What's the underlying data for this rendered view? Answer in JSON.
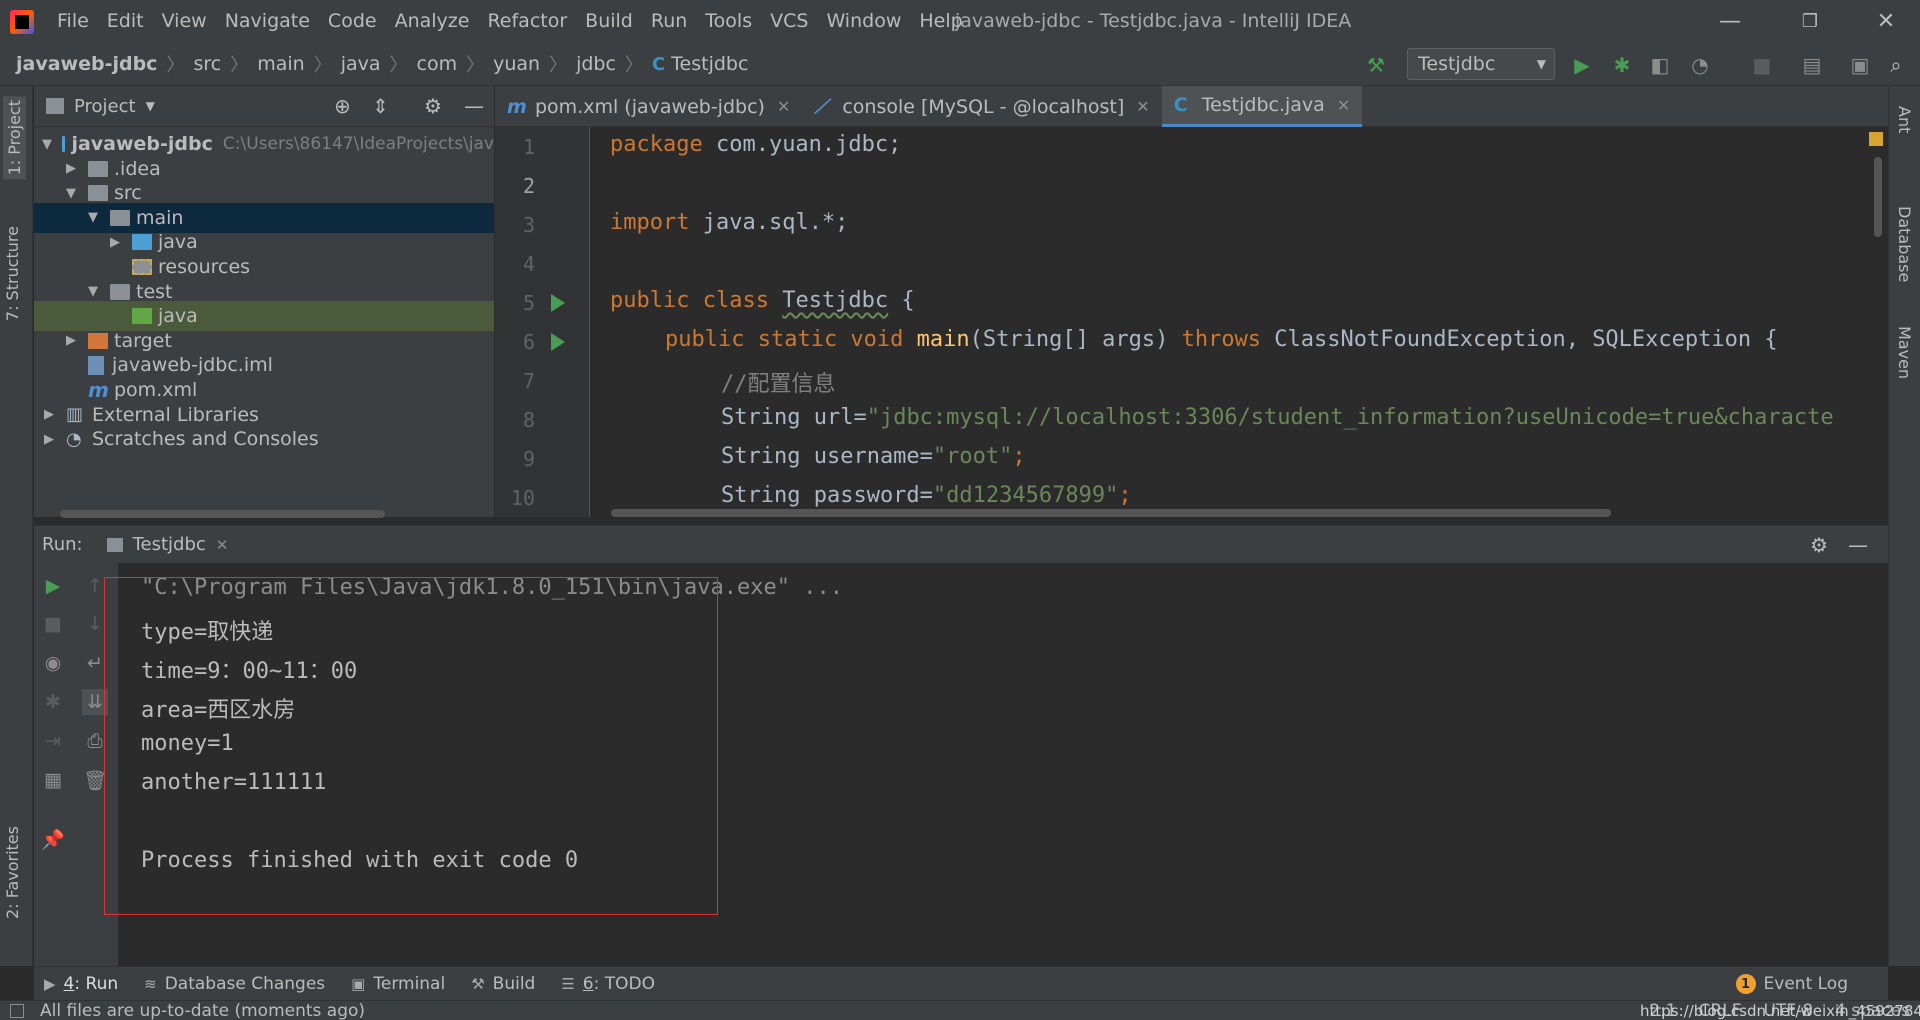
{
  "app": {
    "window_title": "javaweb-jdbc - Testjdbc.java - IntelliJ IDEA",
    "menu": [
      "File",
      "Edit",
      "View",
      "Navigate",
      "Code",
      "Analyze",
      "Refactor",
      "Build",
      "Run",
      "Tools",
      "VCS",
      "Window",
      "Help"
    ],
    "window_controls": {
      "minimize": "—",
      "restore": "❐",
      "close": "✕"
    }
  },
  "breadcrumbs": [
    "javaweb-jdbc",
    "src",
    "main",
    "java",
    "com",
    "yuan",
    "jdbc",
    "Testjdbc"
  ],
  "toolbar": {
    "run_config": "Testjdbc",
    "icons": [
      "hammer-icon",
      "run-icon",
      "debug-icon",
      "coverage-icon",
      "profile-icon",
      "stop-icon",
      "project-structure-icon",
      "terminal-icon",
      "search-icon"
    ]
  },
  "left_stripe": {
    "project": "1: Project",
    "structure": "7: Structure",
    "favorites": "2: Favorites"
  },
  "right_stripe": {
    "ant": "Ant",
    "database": "Database",
    "maven": "Maven"
  },
  "project_panel": {
    "title": "Project",
    "tree": [
      {
        "label": "javaweb-jdbc",
        "hint": "C:\\Users\\86147\\IdeaProjects\\jav",
        "depth": 0,
        "expanded": true,
        "icon": "module-folder"
      },
      {
        "label": ".idea",
        "depth": 1,
        "expanded": false,
        "icon": "folder"
      },
      {
        "label": "src",
        "depth": 1,
        "expanded": true,
        "icon": "folder"
      },
      {
        "label": "main",
        "depth": 2,
        "expanded": true,
        "icon": "folder",
        "state": "selected"
      },
      {
        "label": "java",
        "depth": 3,
        "expanded": false,
        "icon": "source-folder"
      },
      {
        "label": "resources",
        "depth": 3,
        "icon": "resources-folder"
      },
      {
        "label": "test",
        "depth": 2,
        "expanded": true,
        "icon": "folder"
      },
      {
        "label": "java",
        "depth": 3,
        "icon": "test-folder",
        "state": "highlight"
      },
      {
        "label": "target",
        "depth": 1,
        "expanded": false,
        "icon": "excluded-folder"
      },
      {
        "label": "javaweb-jdbc.iml",
        "depth": 1,
        "icon": "iml-file"
      },
      {
        "label": "pom.xml",
        "depth": 1,
        "icon": "maven-file"
      },
      {
        "label": "External Libraries",
        "depth": 0,
        "expanded": false,
        "icon": "libraries"
      },
      {
        "label": "Scratches and Consoles",
        "depth": 0,
        "expanded": false,
        "icon": "scratches"
      }
    ]
  },
  "editor": {
    "tabs": [
      {
        "label": "pom.xml (javaweb-jdbc)",
        "icon": "m",
        "active": false
      },
      {
        "label": "console [MySQL - @localhost]",
        "icon": "sql",
        "active": false
      },
      {
        "label": "Testjdbc.java",
        "icon": "c",
        "active": true
      }
    ],
    "line_numbers": [
      "1",
      "2",
      "3",
      "4",
      "5",
      "6",
      "7",
      "8",
      "9",
      "10"
    ],
    "code": {
      "l1_kw": "package",
      "l1_rest": " com.yuan.jdbc;",
      "l3_kw": "import",
      "l3_rest": " java.sql.*;",
      "l5_kw": "public class",
      "l5_cls": "Testjdbc",
      "l5_rest": " {",
      "l6_kw1": "public static void",
      "l6_fn": "main",
      "l6_args": "(String[] args) ",
      "l6_kw2": "throws",
      "l6_ex": " ClassNotFoundException, SQLException {",
      "l7_cm": "//配置信息",
      "l8_a": "String url=",
      "l8_str": "\"jdbc:mysql://localhost:3306/student_information?useUnicode=true&characte",
      "l9_a": "String username=",
      "l9_str": "\"root\"",
      "l9_end": ";",
      "l10_a": "String password=",
      "l10_str": "\"dd1234567899\"",
      "l10_end": ";"
    }
  },
  "run_panel": {
    "label": "Run:",
    "tab": "Testjdbc",
    "console": [
      "\"C:\\Program Files\\Java\\jdk1.8.0_151\\bin\\java.exe\" ...",
      "type=取快递",
      "time=9：00~11：00",
      "area=西区水房",
      "money=1",
      "another=111111",
      "",
      "Process finished with exit code 0"
    ]
  },
  "bottom_tabs": [
    {
      "key": "4",
      "label": "Run",
      "icon": "run-icon",
      "active": true
    },
    {
      "key": "",
      "label": "Database Changes",
      "icon": "database-icon"
    },
    {
      "key": "",
      "label": "Terminal",
      "icon": "terminal-icon"
    },
    {
      "key": "",
      "label": "Build",
      "icon": "hammer-icon"
    },
    {
      "key": "6",
      "label": "TODO",
      "icon": "todo-icon"
    }
  ],
  "event_log": {
    "count": "1",
    "label": "Event Log"
  },
  "status": {
    "message": "All files are up-to-date (moments ago)",
    "position": "2:1",
    "line_sep": "CRLF",
    "encoding": "UTF-8",
    "indent": "4 spaces",
    "watermark": "https://blog.csdn.net/weixin_45927841"
  },
  "colors": {
    "accent": "#4a88c7",
    "run_green": "#499c54",
    "highlight_box": "#e03030"
  }
}
